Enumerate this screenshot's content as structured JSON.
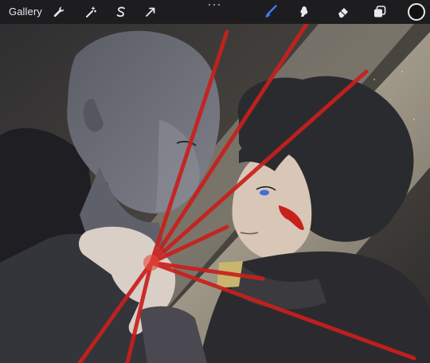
{
  "toolbar": {
    "gallery_label": "Gallery",
    "left_tools": [
      {
        "icon": "wrench-icon",
        "name": "actions"
      },
      {
        "icon": "magic-wand-icon",
        "name": "adjustments"
      },
      {
        "icon": "selection-icon",
        "name": "selection"
      },
      {
        "icon": "transform-arrow-icon",
        "name": "transform"
      }
    ],
    "right_tools": [
      {
        "icon": "brush-icon",
        "name": "brush",
        "active": true
      },
      {
        "icon": "smudge-icon",
        "name": "smudge"
      },
      {
        "icon": "eraser-icon",
        "name": "eraser"
      },
      {
        "icon": "layers-icon",
        "name": "layers"
      },
      {
        "icon": "color-swatch-icon",
        "name": "color"
      }
    ],
    "active_color": "#111111",
    "accent_color": "#3a7bff"
  },
  "canvas": {
    "palette": {
      "background": "#3a3835",
      "light_beam": "#c9c0ad",
      "skin_grey": "#6d6f78",
      "skin_warm": "#d8c6b6",
      "hair": "#2a2b2f",
      "armor": "#1f1e22",
      "blood_red": "#c8201d",
      "eye_blue": "#3e6fe0"
    }
  }
}
